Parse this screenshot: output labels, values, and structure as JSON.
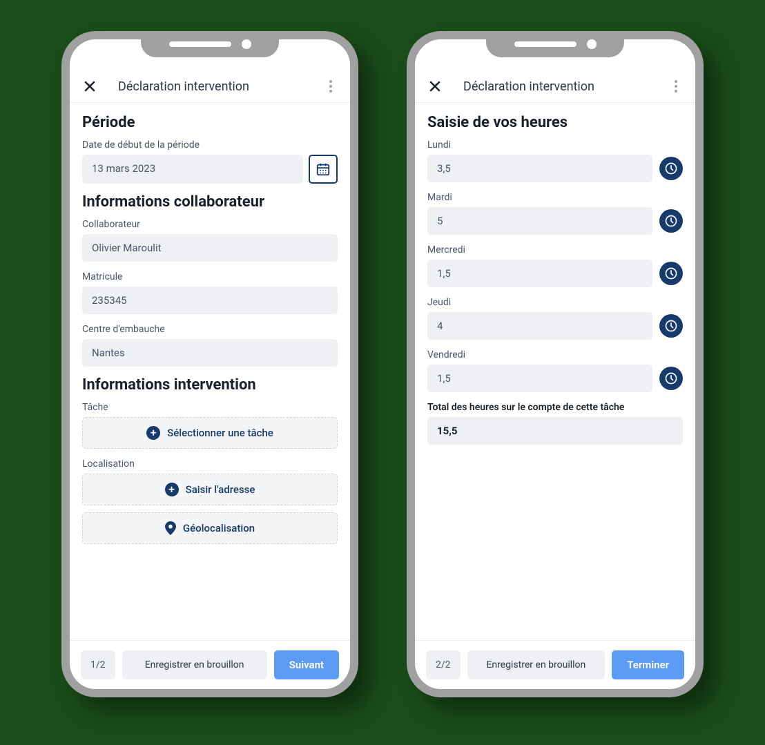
{
  "phone1": {
    "header": {
      "title": "Déclaration intervention"
    },
    "period": {
      "section_title": "Période",
      "date_label": "Date de début de la période",
      "date_value": "13 mars 2023"
    },
    "collab": {
      "section_title": "Informations collaborateur",
      "name_label": "Collaborateur",
      "name_value": "Olivier Maroulit",
      "matricule_label": "Matricule",
      "matricule_value": "235345",
      "centre_label": "Centre d'embauche",
      "centre_value": "Nantes"
    },
    "interv": {
      "section_title": "Informations intervention",
      "task_label": "Tâche",
      "select_task": "Sélectionner une tâche",
      "loc_label": "Localisation",
      "enter_address": "Saisir l'adresse",
      "geoloc": "Géolocalisation"
    },
    "footer": {
      "page": "1/2",
      "draft": "Enregistrer en brouillon",
      "next": "Suivant"
    }
  },
  "phone2": {
    "header": {
      "title": "Déclaration intervention"
    },
    "hours": {
      "section_title": "Saisie de vos heures",
      "days": [
        {
          "label": "Lundi",
          "value": "3,5"
        },
        {
          "label": "Mardi",
          "value": "5"
        },
        {
          "label": "Mercredi",
          "value": "1,5"
        },
        {
          "label": "Jeudi",
          "value": "4"
        },
        {
          "label": "Vendredi",
          "value": "1,5"
        }
      ],
      "total_label": "Total des heures sur le compte de cette tâche",
      "total_value": "15,5"
    },
    "footer": {
      "page": "2/2",
      "draft": "Enregistrer en brouillon",
      "finish": "Terminer"
    }
  },
  "colors": {
    "accent_dark": "#153a6b",
    "accent_blue": "#5b9bf4"
  }
}
